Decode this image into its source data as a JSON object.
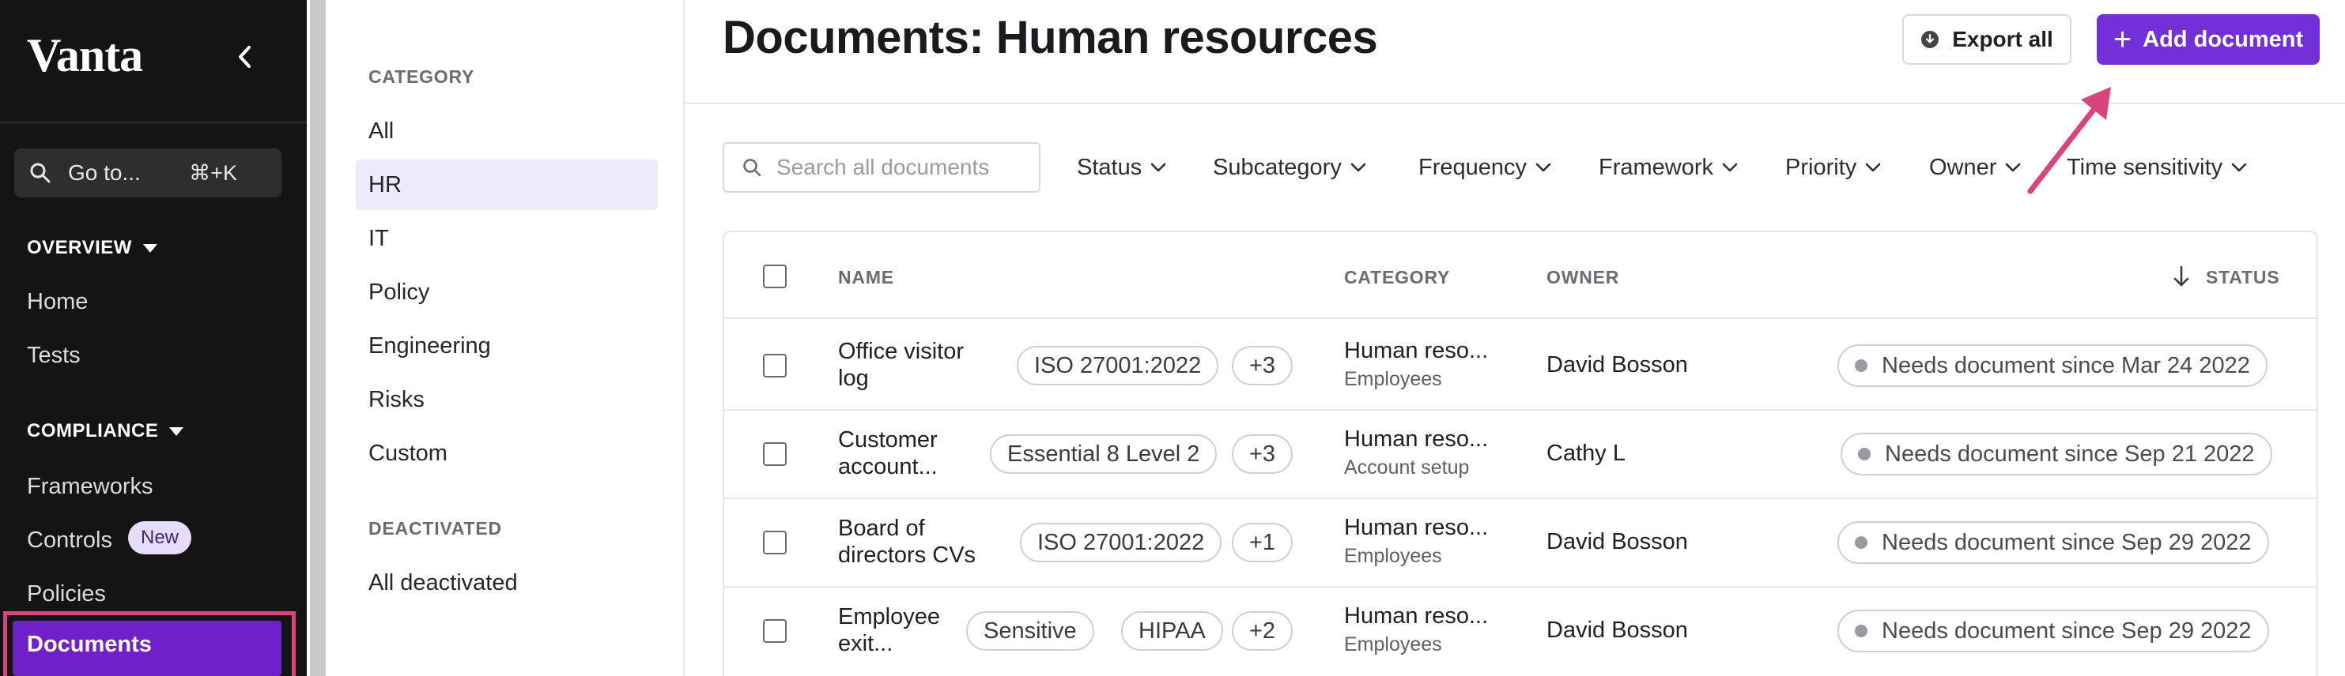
{
  "sidebar": {
    "logo": "Vanta",
    "goto_label": "Go to...",
    "goto_shortcut": "⌘+K",
    "overview_label": "OVERVIEW",
    "home": "Home",
    "tests": "Tests",
    "compliance_label": "COMPLIANCE",
    "frameworks": "Frameworks",
    "controls": "Controls",
    "controls_badge": "New",
    "policies": "Policies",
    "documents": "Documents"
  },
  "categories": {
    "category_heading": "CATEGORY",
    "items": [
      "All",
      "HR",
      "IT",
      "Policy",
      "Engineering",
      "Risks",
      "Custom"
    ],
    "selected": "HR",
    "deactivated_heading": "DEACTIVATED",
    "deactivated_item": "All deactivated"
  },
  "header": {
    "title": "Documents: Human resources",
    "export_label": "Export all",
    "add_label": "Add document"
  },
  "filters": {
    "search_placeholder": "Search all documents",
    "items": [
      "Status",
      "Subcategory",
      "Frequency",
      "Framework",
      "Priority",
      "Owner",
      "Time sensitivity"
    ]
  },
  "table": {
    "columns": {
      "name": "NAME",
      "category": "CATEGORY",
      "owner": "OWNER",
      "status": "STATUS"
    },
    "rows": [
      {
        "name_line1": "Office visitor",
        "name_line2": "log",
        "tags": [
          "ISO 27001:2022",
          "+3"
        ],
        "category": "Human reso...",
        "subcategory": "Employees",
        "owner": "David Bosson",
        "status": "Needs document since Mar 24 2022"
      },
      {
        "name_line1": "Customer",
        "name_line2": "account...",
        "tags": [
          "Essential 8 Level 2",
          "+3"
        ],
        "category": "Human reso...",
        "subcategory": "Account setup",
        "owner": "Cathy L",
        "status": "Needs document since Sep 21 2022"
      },
      {
        "name_line1": "Board of",
        "name_line2": "directors CVs",
        "tags": [
          "ISO 27001:2022",
          "+1"
        ],
        "category": "Human reso...",
        "subcategory": "Employees",
        "owner": "David Bosson",
        "status": "Needs document since Sep 29 2022"
      },
      {
        "name_line1": "Employee",
        "name_line2": "exit...",
        "tags": [
          "Sensitive",
          "HIPAA",
          "+2"
        ],
        "category": "Human reso...",
        "subcategory": "Employees",
        "owner": "David Bosson",
        "status": "Needs document since Sep 29 2022"
      }
    ]
  },
  "colors": {
    "brand_purple": "#7330d9",
    "highlight_pink": "#d9447d",
    "sidebar_bg": "#141414"
  }
}
